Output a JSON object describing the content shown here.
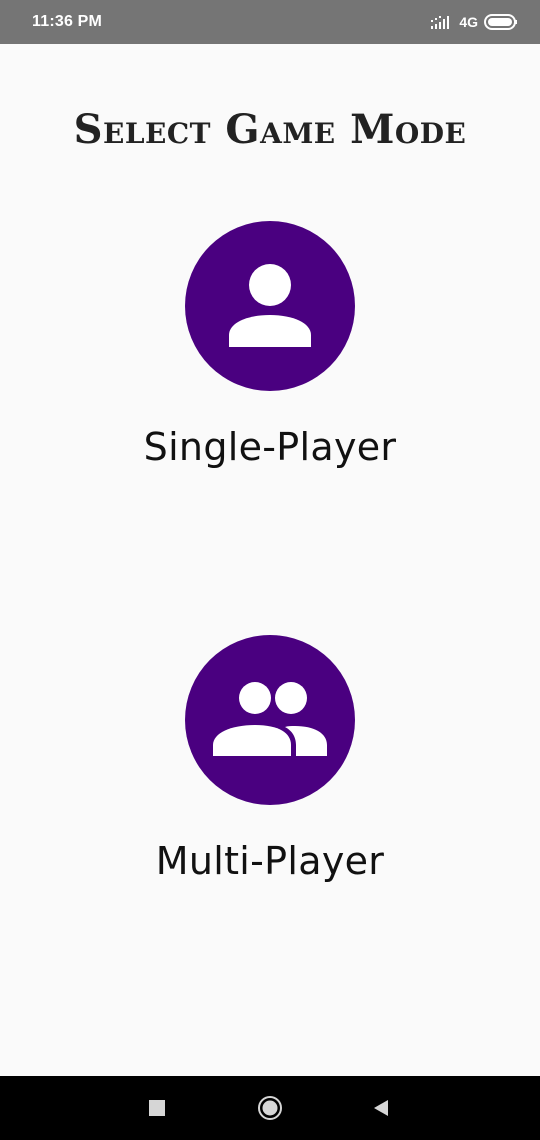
{
  "status_bar": {
    "time": "11:36 PM",
    "network": "4G",
    "icons": [
      "signal-icon",
      "battery-icon"
    ]
  },
  "page": {
    "title": "Select Game Mode"
  },
  "modes": [
    {
      "label": "Single-Player",
      "icon": "single-person-icon"
    },
    {
      "label": "Multi-Player",
      "icon": "group-people-icon"
    }
  ],
  "nav_bar": {
    "icons": [
      "recents-square-icon",
      "home-circle-icon",
      "back-triangle-icon"
    ]
  },
  "colors": {
    "accent": "#4a0080",
    "background": "#fafafa",
    "status_bar": "#757575",
    "nav_bar": "#000000"
  }
}
